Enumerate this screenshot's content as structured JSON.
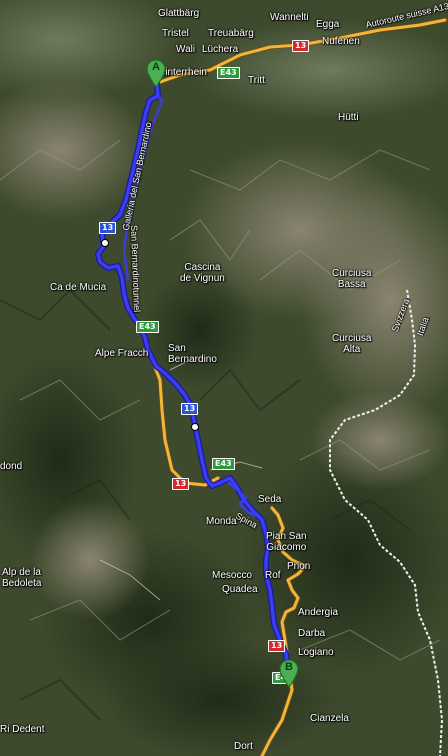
{
  "map": {
    "colors": {
      "route": "#3c3cf0",
      "route_outline": "#1a1aa0",
      "road_major": "#f2b53b",
      "border": "#e6e6e6",
      "marker": "#4caf50",
      "marker_stroke": "#1f6d22",
      "euro_shield": "#2f9a3a",
      "national_shield": "#d22b2b",
      "motorway_shield": "#2c54d8"
    },
    "markers": {
      "start": "A",
      "end": "B"
    },
    "labels": {
      "glattbarg": "Glattbärg",
      "wannelti": "Wannelti",
      "egga": "Egga",
      "tristel": "Tristel",
      "treuabarg": "Treuabärg",
      "nufenen": "Nufenen",
      "autoroute": "Autoroute suisse A13",
      "wali": "Wali",
      "luchera": "Lüchera",
      "hinterrhein": "Hinterrhein",
      "tritt": "Tritt",
      "hutti": "Hütti",
      "galleria": "Galleria del San Bernardino",
      "tunnel": "San Bernardinotunnel",
      "cascina": "Cascina\nde Vignun",
      "ca_de_mucia": "Ca de Mucia",
      "curciusa_bassa": "Curciusa\nBassa",
      "svizzera": "Svizzera",
      "italia": "Italia",
      "curciusa_alta": "Curciusa\nAlta",
      "alpe_fracch": "Alpe Fracch",
      "san_bernardino": "San\nBernardino",
      "dond": "dond",
      "seda": "Seda",
      "spina": "Spina",
      "monda": "Monda",
      "pian_san_giacomo": "Pian San\nGiacomo",
      "alp_bedoleta": "Alp de la\nBedoleta",
      "mesocco": "Mesocco",
      "prion": "Prion",
      "quadea": "Quadea",
      "rof": "Rof",
      "andergia": "Andergia",
      "darba": "Darba",
      "logiano": "Logiano",
      "cianzela": "Cianzela",
      "ri_dedent": "Ri Dedent",
      "dort": "Dort"
    },
    "shields": {
      "n13_a": "13",
      "e43_a": "E43",
      "a13_a": "13",
      "e43_b": "E43",
      "a13_b": "13",
      "n13_b": "13",
      "e43_c": "E43",
      "n13_c": "13",
      "e43_d": "E4"
    }
  }
}
